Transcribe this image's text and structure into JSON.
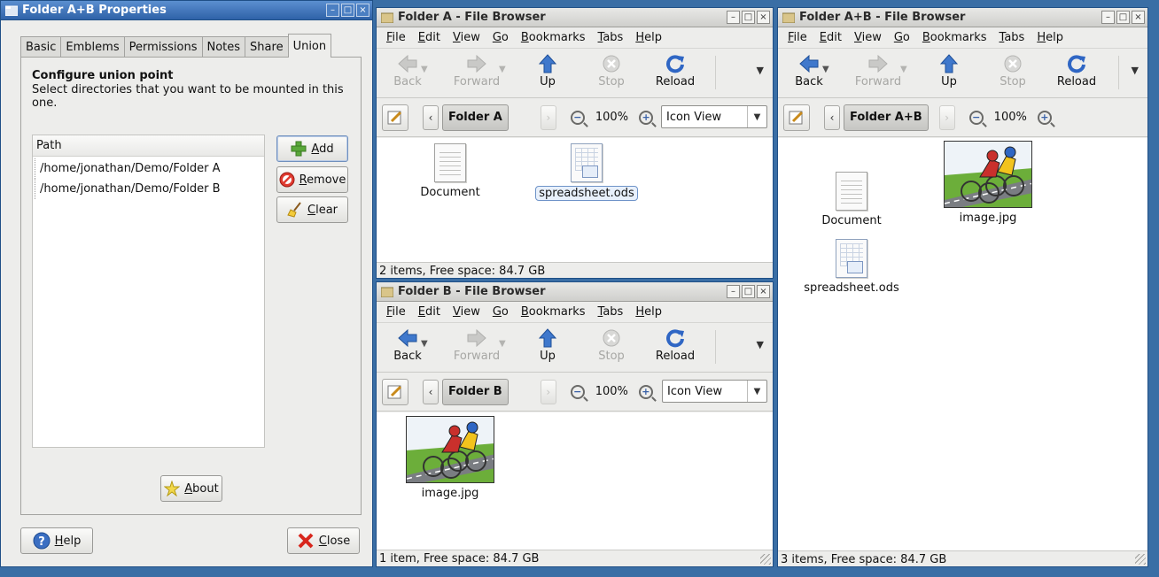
{
  "colors": {
    "titlebar_active": "#2f62a8",
    "window_bg": "#ededeb",
    "desktop": "#3a6ea5"
  },
  "props": {
    "title": "Folder A+B Properties",
    "tabs": [
      "Basic",
      "Emblems",
      "Permissions",
      "Notes",
      "Share",
      "Union"
    ],
    "active_tab": "Union",
    "heading": "Configure union point",
    "subheading": "Select directories that you want to be mounted in this one.",
    "list_header": "Path",
    "paths": [
      "/home/jonathan/Demo/Folder A",
      "/home/jonathan/Demo/Folder B"
    ],
    "add_label": "Add",
    "remove_label": "Remove",
    "clear_label": "Clear",
    "about_label": "About",
    "help_label": "Help",
    "close_label": "Close"
  },
  "menu": [
    "File",
    "Edit",
    "View",
    "Go",
    "Bookmarks",
    "Tabs",
    "Help"
  ],
  "toolbar": {
    "back": "Back",
    "forward": "Forward",
    "up": "Up",
    "stop": "Stop",
    "reload": "Reload"
  },
  "winA": {
    "title": "Folder A - File Browser",
    "location": "Folder A",
    "zoom": "100%",
    "view": "Icon View",
    "files": [
      "Document",
      "spreadsheet.ods"
    ],
    "status": "2 items, Free space: 84.7 GB"
  },
  "winB": {
    "title": "Folder B - File Browser",
    "location": "Folder B",
    "zoom": "100%",
    "view": "Icon View",
    "files": [
      "image.jpg"
    ],
    "status": "1 item, Free space: 84.7 GB"
  },
  "winAB": {
    "title": "Folder A+B - File Browser",
    "location": "Folder A+B",
    "zoom": "100%",
    "files": [
      "Document",
      "image.jpg",
      "spreadsheet.ods"
    ],
    "status": "3 items, Free space: 84.7 GB"
  }
}
